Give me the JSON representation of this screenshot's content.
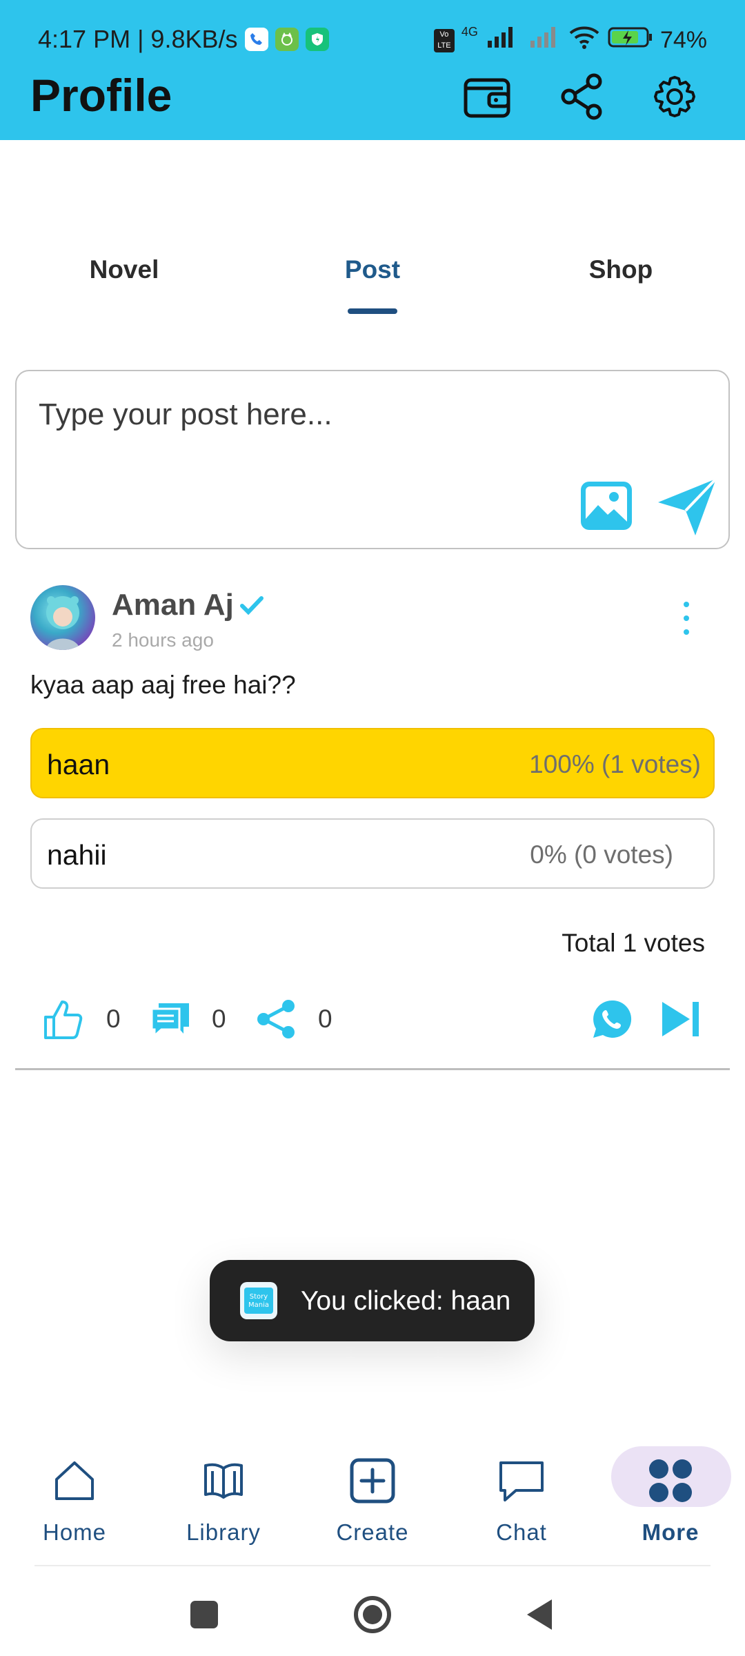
{
  "status_bar": {
    "time_speed": "4:17 PM | 9.8KB/s",
    "network": "4G",
    "battery": "74%"
  },
  "header": {
    "title": "Profile",
    "icons": [
      "wallet-icon",
      "share-icon",
      "settings-gear-icon"
    ],
    "background": "#2ec4ec"
  },
  "tabs": [
    {
      "label": "Novel",
      "active": false
    },
    {
      "label": "Post",
      "active": true
    },
    {
      "label": "Shop",
      "active": false
    }
  ],
  "composer": {
    "placeholder": "Type your post here..."
  },
  "post": {
    "author": "Aman Aj",
    "time_ago": "2 hours ago",
    "text": "kyaa aap aaj free hai??",
    "poll": [
      {
        "label": "haan",
        "result": "100% (1 votes)",
        "selected": true
      },
      {
        "label": "nahii",
        "result": "0% (0 votes)",
        "selected": false
      }
    ],
    "total_votes": "Total 1 votes",
    "likes": "0",
    "comments": "0",
    "shares": "0"
  },
  "toast": {
    "text": "You clicked: haan"
  },
  "bottom_nav": [
    {
      "label": "Home",
      "icon": "home-icon"
    },
    {
      "label": "Library",
      "icon": "book-icon"
    },
    {
      "label": "Create",
      "icon": "plus-square-icon"
    },
    {
      "label": "Chat",
      "icon": "chat-bubble-icon"
    },
    {
      "label": "More",
      "icon": "grid-dots-icon",
      "active": true
    }
  ],
  "colors": {
    "accent": "#2ec4ec",
    "navy": "#1f4f80",
    "poll_selected": "#ffd500",
    "nav_active_pill": "#ebe2f5"
  }
}
